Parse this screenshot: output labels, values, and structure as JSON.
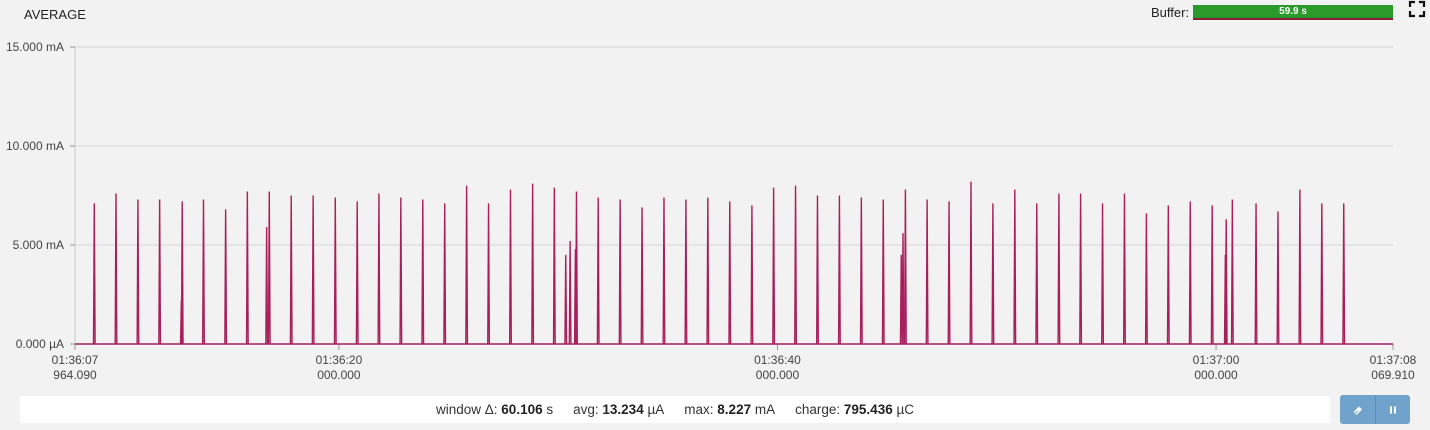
{
  "header": {
    "mode_label": "AVERAGE",
    "buffer_label": "Buffer:",
    "buffer_value": "59.9 s",
    "buffer_fraction": 1.0
  },
  "chart_data": {
    "type": "line",
    "ylabel_unit": "mA",
    "ylim": [
      0,
      15
    ],
    "y_ticks": [
      {
        "value": 0,
        "label": "0.000 µA"
      },
      {
        "value": 5,
        "label": "5.000 mA"
      },
      {
        "value": 10,
        "label": "10.000 mA"
      },
      {
        "value": 15,
        "label": "15.000 mA"
      }
    ],
    "xlim_seconds": [
      0,
      60.106
    ],
    "x_ticks": [
      {
        "value": 0,
        "time": "01:36:07",
        "frac": "964.090"
      },
      {
        "value": 12.036,
        "time": "01:36:20",
        "frac": "000.000"
      },
      {
        "value": 32.036,
        "time": "01:36:40",
        "frac": "000.000"
      },
      {
        "value": 52.036,
        "time": "01:37:00",
        "frac": "000.000"
      },
      {
        "value": 60.106,
        "time": "01:37:08",
        "frac": "069.910"
      }
    ],
    "grid": true,
    "series": [
      {
        "color": "#a8205a",
        "spikes": [
          {
            "t": 0.88,
            "v": 7.1
          },
          {
            "t": 1.87,
            "v": 7.6
          },
          {
            "t": 2.87,
            "v": 7.3
          },
          {
            "t": 3.86,
            "v": 7.3
          },
          {
            "t": 4.85,
            "v": 2.2
          },
          {
            "t": 4.89,
            "v": 7.2
          },
          {
            "t": 5.86,
            "v": 7.3
          },
          {
            "t": 6.87,
            "v": 6.8
          },
          {
            "t": 7.86,
            "v": 7.7
          },
          {
            "t": 8.74,
            "v": 5.9
          },
          {
            "t": 8.86,
            "v": 7.7
          },
          {
            "t": 9.86,
            "v": 7.5
          },
          {
            "t": 10.86,
            "v": 7.5
          },
          {
            "t": 11.87,
            "v": 7.4
          },
          {
            "t": 12.87,
            "v": 7.2
          },
          {
            "t": 13.86,
            "v": 7.6
          },
          {
            "t": 14.86,
            "v": 7.4
          },
          {
            "t": 15.86,
            "v": 7.3
          },
          {
            "t": 16.86,
            "v": 7.1
          },
          {
            "t": 17.86,
            "v": 8.0
          },
          {
            "t": 18.86,
            "v": 7.1
          },
          {
            "t": 19.86,
            "v": 7.8
          },
          {
            "t": 20.87,
            "v": 8.1
          },
          {
            "t": 21.86,
            "v": 7.9
          },
          {
            "t": 22.38,
            "v": 4.5
          },
          {
            "t": 22.58,
            "v": 5.2
          },
          {
            "t": 22.82,
            "v": 4.8
          },
          {
            "t": 22.87,
            "v": 7.7
          },
          {
            "t": 23.86,
            "v": 7.4
          },
          {
            "t": 24.86,
            "v": 7.3
          },
          {
            "t": 25.86,
            "v": 6.9
          },
          {
            "t": 26.86,
            "v": 7.4
          },
          {
            "t": 27.86,
            "v": 7.3
          },
          {
            "t": 28.86,
            "v": 7.4
          },
          {
            "t": 29.86,
            "v": 7.2
          },
          {
            "t": 30.87,
            "v": 7.0
          },
          {
            "t": 31.86,
            "v": 7.9
          },
          {
            "t": 32.86,
            "v": 8.0
          },
          {
            "t": 33.86,
            "v": 7.5
          },
          {
            "t": 34.86,
            "v": 7.5
          },
          {
            "t": 35.86,
            "v": 7.4
          },
          {
            "t": 36.86,
            "v": 7.3
          },
          {
            "t": 37.68,
            "v": 4.5
          },
          {
            "t": 37.76,
            "v": 5.6
          },
          {
            "t": 37.87,
            "v": 7.8
          },
          {
            "t": 38.86,
            "v": 7.3
          },
          {
            "t": 39.86,
            "v": 7.2
          },
          {
            "t": 40.86,
            "v": 8.2
          },
          {
            "t": 41.86,
            "v": 7.1
          },
          {
            "t": 42.86,
            "v": 7.8
          },
          {
            "t": 43.86,
            "v": 7.1
          },
          {
            "t": 44.87,
            "v": 7.6
          },
          {
            "t": 45.86,
            "v": 7.6
          },
          {
            "t": 46.86,
            "v": 7.1
          },
          {
            "t": 47.86,
            "v": 7.6
          },
          {
            "t": 48.86,
            "v": 6.6
          },
          {
            "t": 49.86,
            "v": 7.0
          },
          {
            "t": 50.86,
            "v": 7.2
          },
          {
            "t": 51.86,
            "v": 7.0
          },
          {
            "t": 52.46,
            "v": 4.5
          },
          {
            "t": 52.5,
            "v": 6.3
          },
          {
            "t": 52.78,
            "v": 7.3
          },
          {
            "t": 53.86,
            "v": 7.1
          },
          {
            "t": 54.86,
            "v": 6.7
          },
          {
            "t": 55.86,
            "v": 7.8
          },
          {
            "t": 56.86,
            "v": 7.1
          },
          {
            "t": 57.86,
            "v": 7.1
          }
        ]
      }
    ]
  },
  "stats": {
    "window_label": "window Δ:",
    "window_value": "60.106",
    "window_unit": "s",
    "avg_label": "avg:",
    "avg_value": "13.234",
    "avg_unit": "µA",
    "max_label": "max:",
    "max_value": "8.227",
    "max_unit": "mA",
    "charge_label": "charge:",
    "charge_value": "795.436",
    "charge_unit": "µC"
  },
  "controls": {
    "clear_icon": "eraser-icon",
    "pause_icon": "pause-icon"
  }
}
